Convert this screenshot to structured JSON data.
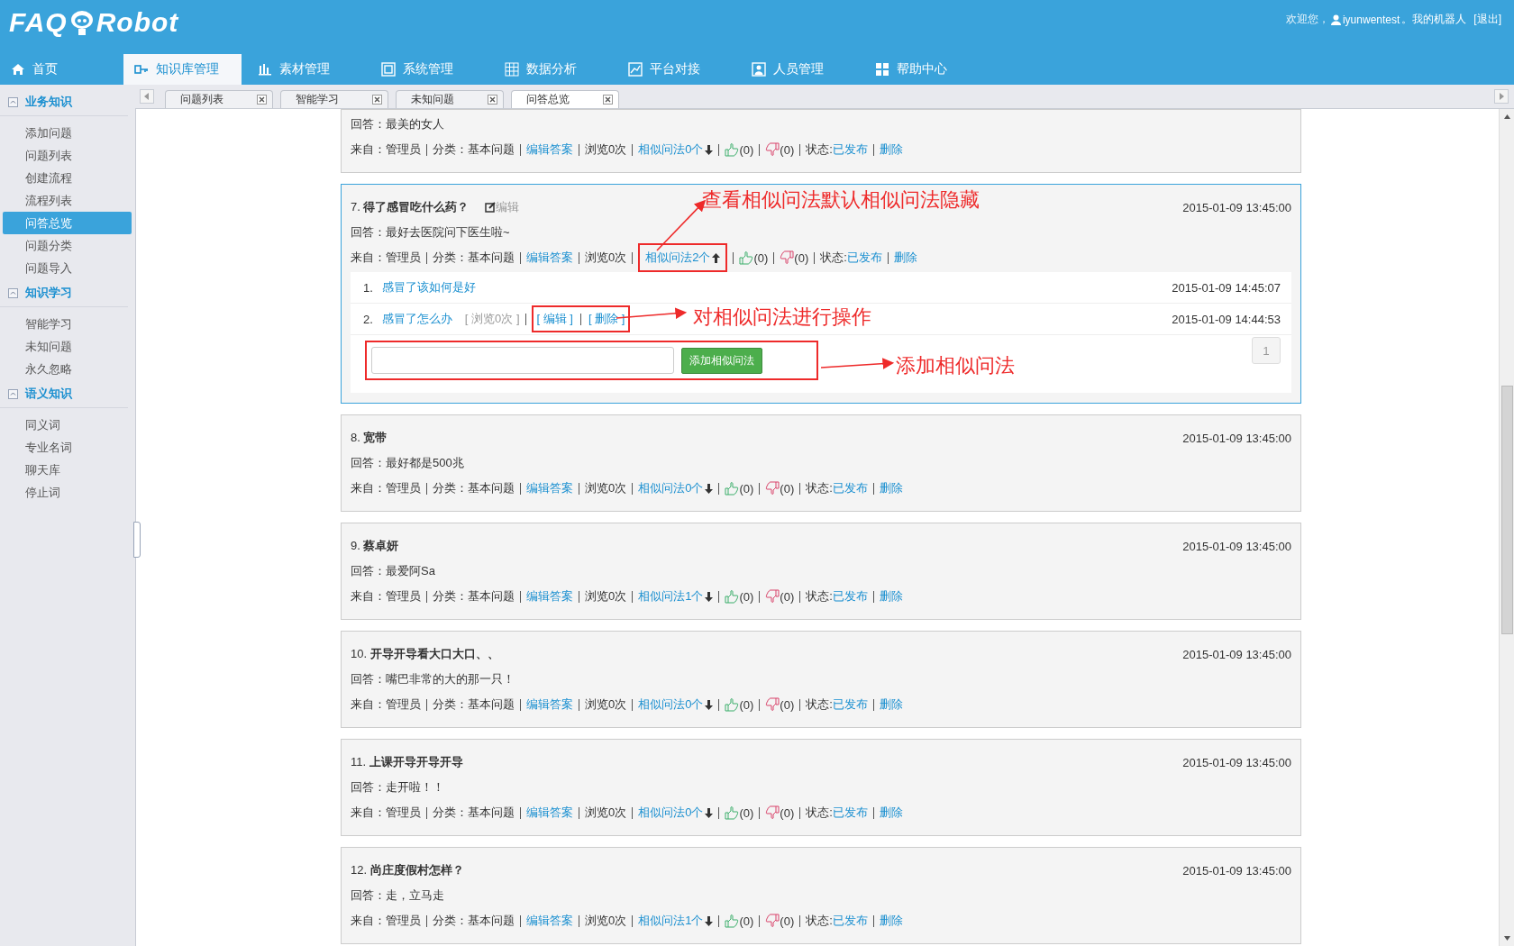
{
  "header": {
    "logo_left": "FAQ",
    "logo_right": "Robot",
    "welcome": "欢迎您，",
    "user": "iyunwentest",
    "my_robot": "。我的机器人",
    "logout": "[退出]"
  },
  "nav": [
    {
      "label": "首页",
      "selected": false
    },
    {
      "label": "知识库管理",
      "selected": true
    },
    {
      "label": "素材管理",
      "selected": false
    },
    {
      "label": "系统管理",
      "selected": false
    },
    {
      "label": "数据分析",
      "selected": false
    },
    {
      "label": "平台对接",
      "selected": false
    },
    {
      "label": "人员管理",
      "selected": false
    },
    {
      "label": "帮助中心",
      "selected": false
    }
  ],
  "sidebar": [
    {
      "title": "业务知识",
      "expanded": true,
      "items": [
        {
          "label": "添加问题",
          "selected": false
        },
        {
          "label": "问题列表",
          "selected": false
        },
        {
          "label": "创建流程",
          "selected": false
        },
        {
          "label": "流程列表",
          "selected": false
        },
        {
          "label": "问答总览",
          "selected": true
        },
        {
          "label": "问题分类",
          "selected": false
        },
        {
          "label": "问题导入",
          "selected": false
        }
      ]
    },
    {
      "title": "知识学习",
      "expanded": true,
      "items": [
        {
          "label": "智能学习",
          "selected": false
        },
        {
          "label": "未知问题",
          "selected": false
        },
        {
          "label": "永久忽略",
          "selected": false
        }
      ]
    },
    {
      "title": "语义知识",
      "expanded": true,
      "items": [
        {
          "label": "同义词",
          "selected": false
        },
        {
          "label": "专业名词",
          "selected": false
        },
        {
          "label": "聊天库",
          "selected": false
        },
        {
          "label": "停止词",
          "selected": false
        }
      ]
    }
  ],
  "tabs": [
    {
      "label": "问题列表",
      "selected": false
    },
    {
      "label": "智能学习",
      "selected": false
    },
    {
      "label": "未知问题",
      "selected": false
    },
    {
      "label": "问答总览",
      "selected": true
    }
  ],
  "cards": [
    {
      "answer": "回答：最美的女人",
      "source": "来自：管理员",
      "category": "分类：基本问题",
      "edit_answer": "编辑答案",
      "views": "浏览0次",
      "similar": "相似问法0个",
      "expanded": false,
      "likes": "(0)",
      "dislikes": "(0)",
      "status_label": "状态:",
      "status": "已发布",
      "delete": "删除"
    },
    {
      "number": "7.",
      "title": "得了感冒吃什么药？",
      "edit_label": "编辑",
      "time": "2015-01-09 13:45:00",
      "answer": "回答：最好去医院问下医生啦~",
      "source": "来自：管理员",
      "category": "分类：基本问题",
      "edit_answer": "编辑答案",
      "views": "浏览0次",
      "similar": "相似问法2个",
      "expanded": true,
      "likes": "(0)",
      "dislikes": "(0)",
      "status_label": "状态:",
      "status": "已发布",
      "delete": "删除",
      "similar_items": [
        {
          "index": "1.",
          "text": "感冒了该如何是好",
          "time": "2015-01-09 14:45:07"
        },
        {
          "index": "2.",
          "text": "感冒了怎么办",
          "views": "[ 浏览0次 ]",
          "edit": "[ 编辑 ]",
          "delete": "[ 删除 ]",
          "time": "2015-01-09 14:44:53"
        }
      ],
      "add_button": "添加相似问法",
      "pager": "1"
    },
    {
      "number": "8.",
      "title": "宽带",
      "time": "2015-01-09 13:45:00",
      "answer": "回答：最好都是500兆",
      "source": "来自：管理员",
      "category": "分类：基本问题",
      "edit_answer": "编辑答案",
      "views": "浏览0次",
      "similar": "相似问法0个",
      "expanded": false,
      "likes": "(0)",
      "dislikes": "(0)",
      "status_label": "状态:",
      "status": "已发布",
      "delete": "删除"
    },
    {
      "number": "9.",
      "title": "蔡卓妍",
      "time": "2015-01-09 13:45:00",
      "answer": "回答：最爱阿Sa",
      "source": "来自：管理员",
      "category": "分类：基本问题",
      "edit_answer": "编辑答案",
      "views": "浏览0次",
      "similar": "相似问法1个",
      "expanded": false,
      "likes": "(0)",
      "dislikes": "(0)",
      "status_label": "状态:",
      "status": "已发布",
      "delete": "删除"
    },
    {
      "number": "10.",
      "title": "开导开导看大口大口、、",
      "time": "2015-01-09 13:45:00",
      "answer": "回答：嘴巴非常的大的那一只！",
      "source": "来自：管理员",
      "category": "分类：基本问题",
      "edit_answer": "编辑答案",
      "views": "浏览0次",
      "similar": "相似问法0个",
      "expanded": false,
      "likes": "(0)",
      "dislikes": "(0)",
      "status_label": "状态:",
      "status": "已发布",
      "delete": "删除"
    },
    {
      "number": "11.",
      "title": "上课开导开导开导",
      "time": "2015-01-09 13:45:00",
      "answer": "回答：走开啦！！",
      "source": "来自：管理员",
      "category": "分类：基本问题",
      "edit_answer": "编辑答案",
      "views": "浏览0次",
      "similar": "相似问法0个",
      "expanded": false,
      "likes": "(0)",
      "dislikes": "(0)",
      "status_label": "状态:",
      "status": "已发布",
      "delete": "删除"
    },
    {
      "number": "12.",
      "title": "尚庄度假村怎样？",
      "time": "2015-01-09 13:45:00",
      "answer": "回答：走，立马走",
      "source": "来自：管理员",
      "category": "分类：基本问题",
      "edit_answer": "编辑答案",
      "views": "浏览0次",
      "similar": "相似问法1个",
      "expanded": false,
      "likes": "(0)",
      "dislikes": "(0)",
      "status_label": "状态:",
      "status": "已发布",
      "delete": "删除"
    }
  ],
  "annotations": [
    {
      "text": "查看相似问法默认相似问法隐藏"
    },
    {
      "text": "对相似问法进行操作"
    },
    {
      "text": "添加相似问法"
    }
  ]
}
